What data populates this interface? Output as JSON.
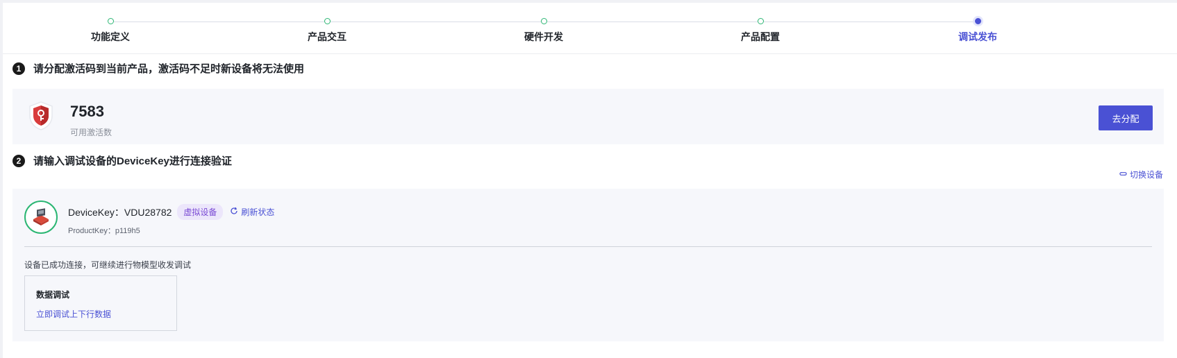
{
  "steps": [
    {
      "label": "功能定义",
      "state": "done"
    },
    {
      "label": "产品交互",
      "state": "done"
    },
    {
      "label": "硬件开发",
      "state": "done"
    },
    {
      "label": "产品配置",
      "state": "done"
    },
    {
      "label": "调试发布",
      "state": "active"
    }
  ],
  "section1": {
    "number": "1",
    "title": "请分配激活码到当前产品，激活码不足时新设备将无法使用",
    "activation_count": "7583",
    "activation_label": "可用激活数",
    "assign_button": "去分配",
    "icon": "shield-key-icon"
  },
  "section2": {
    "number": "2",
    "title": "请输入调试设备的DeviceKey进行连接验证",
    "switch_device": "切换设备",
    "device_key": "DeviceKey：VDU28782",
    "device_badge": "虚拟设备",
    "refresh": "刷新状态",
    "product_key": "ProductKey：p119h5",
    "connection_message": "设备已成功连接，可继续进行物模型收发调试",
    "debug_box_title": "数据调试",
    "debug_box_link": "立即调试上下行数据"
  },
  "colors": {
    "accent": "#4a51d4",
    "success": "#2bb673",
    "badge_bg": "#ece6fb",
    "badge_text": "#7a4ad4"
  }
}
